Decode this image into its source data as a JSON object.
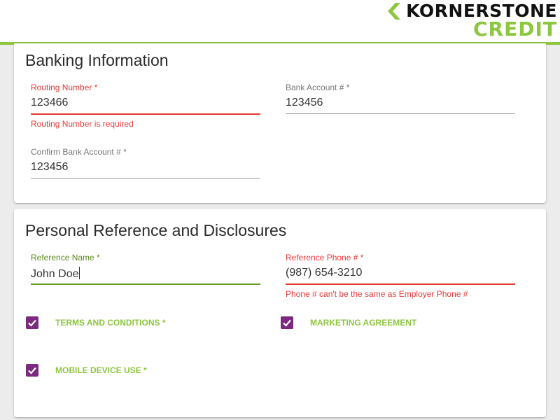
{
  "brand": {
    "name_top": "KORNERSTONE",
    "name_bottom": "CREDIT",
    "accent_color": "#8dc63f",
    "checkbox_color": "#7b2a7f",
    "error_color": "#e53935"
  },
  "banking": {
    "title": "Banking Information",
    "routing": {
      "label": "Routing Number *",
      "value": "123466",
      "error": "Routing Number is required"
    },
    "account": {
      "label": "Bank Account # *",
      "value": "123456"
    },
    "confirm_account": {
      "label": "Confirm Bank Account # *",
      "value": "123456"
    }
  },
  "reference": {
    "title": "Personal Reference and Disclosures",
    "name": {
      "label": "Reference Name *",
      "value": "John Doe"
    },
    "phone": {
      "label": "Reference Phone # *",
      "value": "(987) 654-3210",
      "error": "Phone # can't be the same as Employer Phone #"
    },
    "checkboxes": [
      {
        "label": "TERMS AND CONDITIONS *",
        "checked": true
      },
      {
        "label": "MARKETING AGREEMENT",
        "checked": true
      },
      {
        "label": "MOBILE DEVICE USE *",
        "checked": true
      }
    ]
  }
}
